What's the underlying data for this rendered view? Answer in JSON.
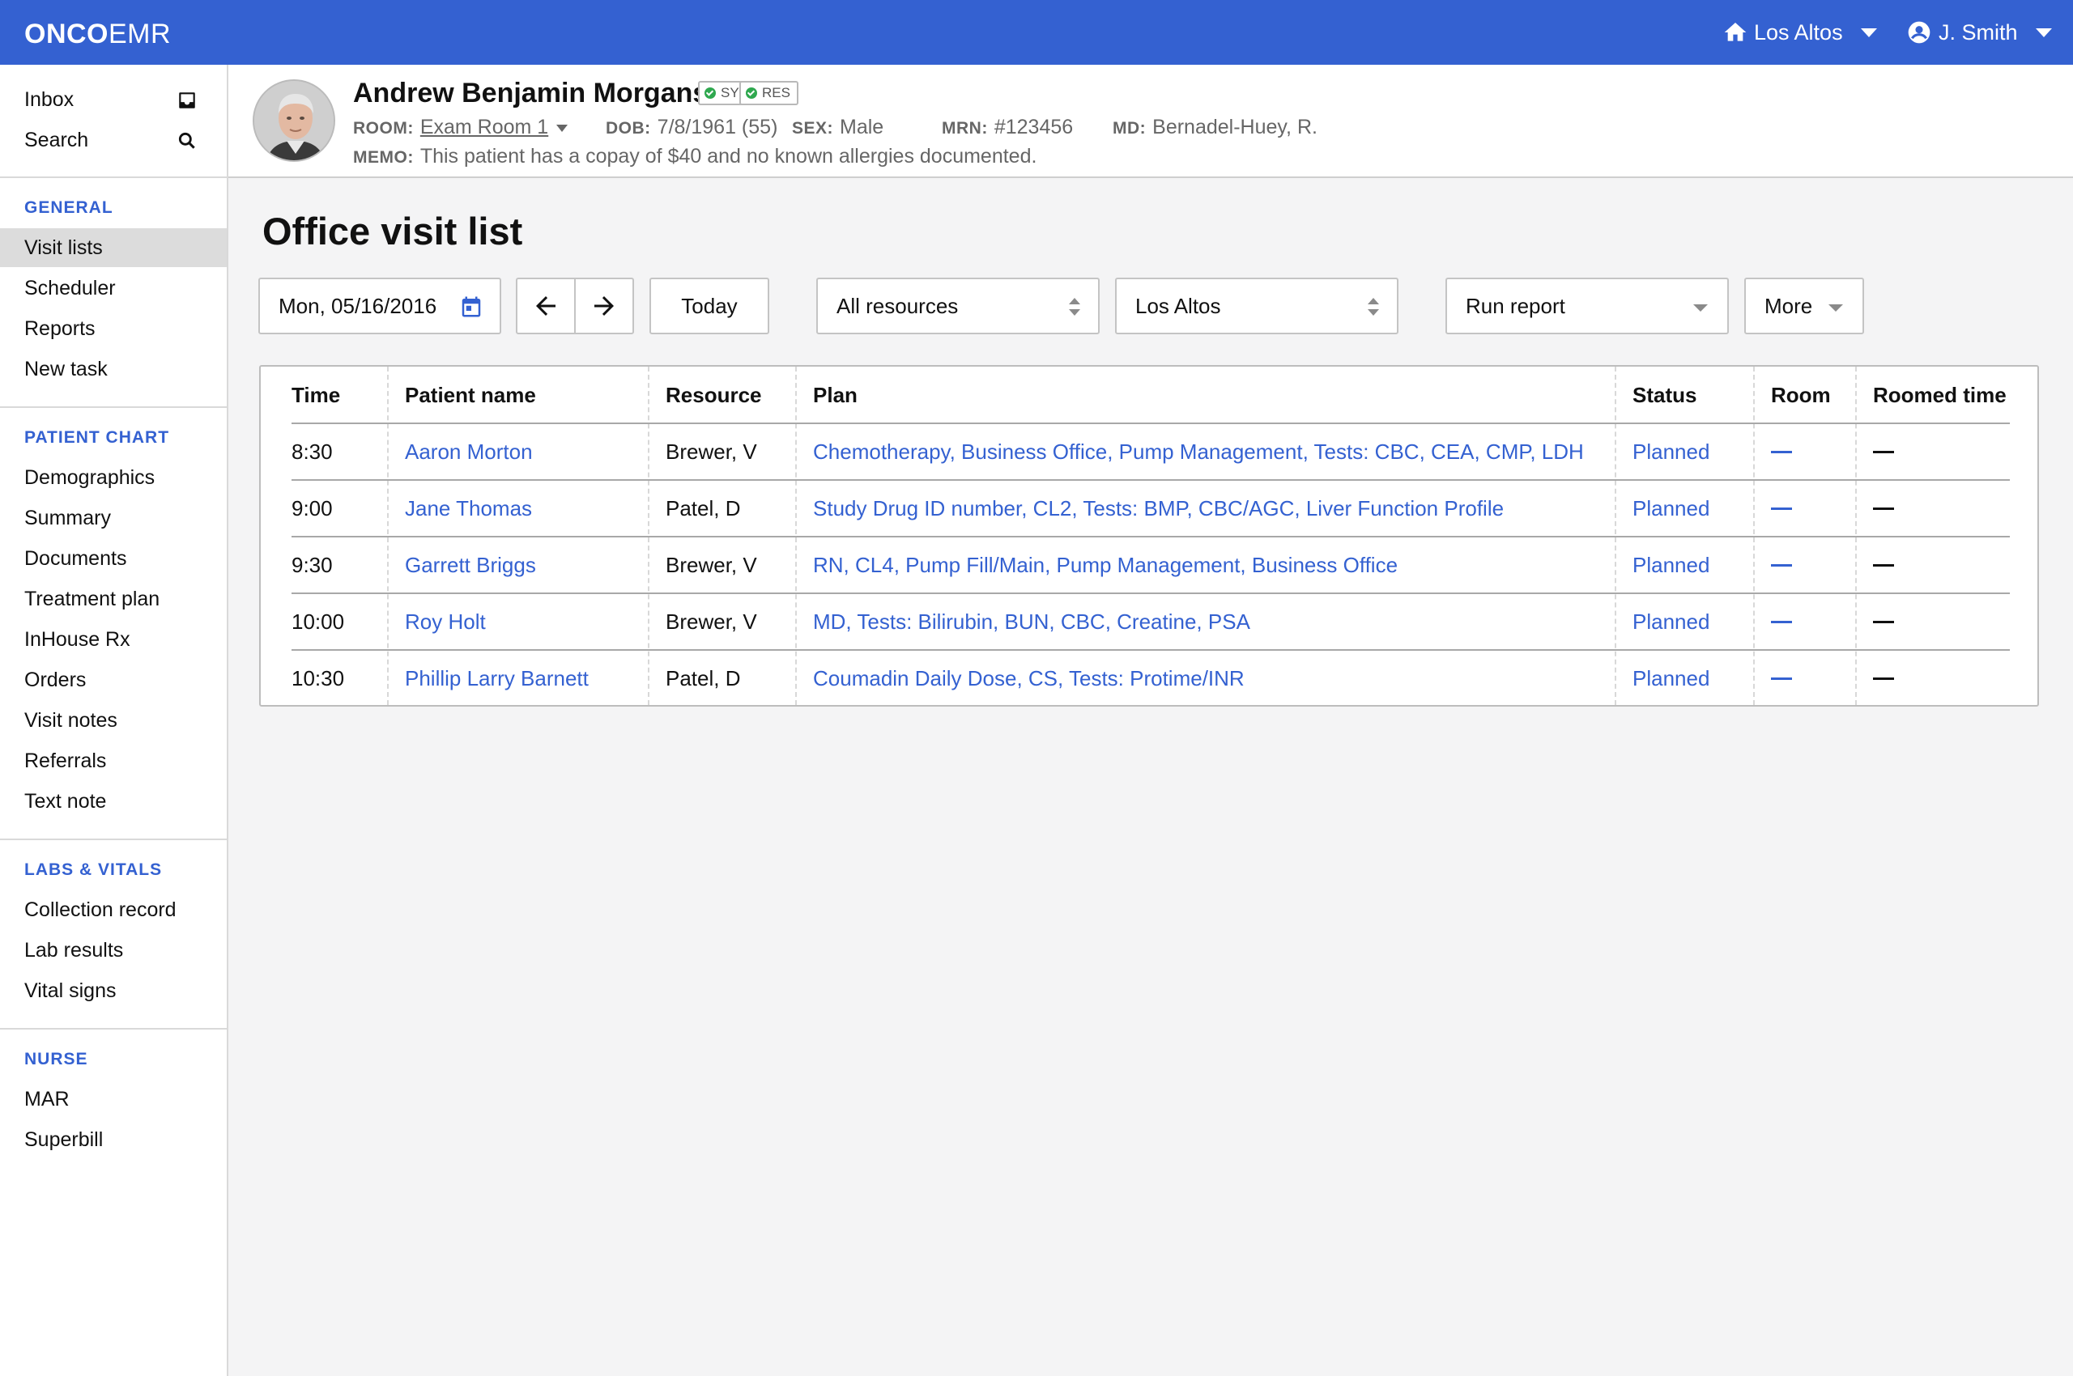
{
  "app": {
    "logo_bold": "ONCO",
    "logo_light": "EMR",
    "location": "Los Altos",
    "user": "J. Smith"
  },
  "sidebar": {
    "top": [
      {
        "label": "Inbox",
        "icon": "inbox-icon"
      },
      {
        "label": "Search",
        "icon": "search-icon"
      }
    ],
    "sections": [
      {
        "heading": "GENERAL",
        "items": [
          "Visit lists",
          "Scheduler",
          "Reports",
          "New task"
        ]
      },
      {
        "heading": "PATIENT CHART",
        "items": [
          "Demographics",
          "Summary",
          "Documents",
          "Treatment plan",
          "InHouse Rx",
          "Orders",
          "Visit notes",
          "Referrals",
          "Text note"
        ]
      },
      {
        "heading": "LABS & VITALS",
        "items": [
          "Collection record",
          "Lab results",
          "Vital signs"
        ]
      },
      {
        "heading": "NURSE",
        "items": [
          "MAR",
          "Superbill"
        ]
      }
    ],
    "active": "Visit lists"
  },
  "patient": {
    "name": "Andrew Benjamin Morganstein",
    "tags": [
      "SYC",
      "RES"
    ],
    "room_key": "ROOM:",
    "room": "Exam Room 1",
    "dob_key": "DOB:",
    "dob": "7/8/1961 (55)",
    "sex_key": "SEX:",
    "sex": "Male",
    "mrn_key": "MRN:",
    "mrn": "#123456",
    "md_key": "MD:",
    "md": "Bernadel-Huey, R.",
    "memo_key": "MEMO:",
    "memo": "This patient has a copay of $40 and no known allergies documented."
  },
  "page": {
    "title": "Office visit list",
    "date": "Mon, 05/16/2016",
    "today": "Today",
    "resources": "All resources",
    "location": "Los Altos",
    "run_report": "Run report",
    "more": "More"
  },
  "table": {
    "headers": [
      "Time",
      "Patient name",
      "Resource",
      "Plan",
      "Status",
      "Room",
      "Roomed time"
    ],
    "rows": [
      {
        "time": "8:30",
        "patient": "Aaron Morton",
        "resource": "Brewer, V",
        "plan": "Chemotherapy, Business Office, Pump Management, Tests: CBC, CEA, CMP, LDH",
        "status": "Planned"
      },
      {
        "time": "9:00",
        "patient": "Jane Thomas",
        "resource": "Patel, D",
        "plan": "Study Drug ID number, CL2, Tests: BMP, CBC/AGC, Liver Function Profile",
        "status": "Planned"
      },
      {
        "time": "9:30",
        "patient": "Garrett Briggs",
        "resource": "Brewer, V",
        "plan": "RN, CL4, Pump Fill/Main, Pump Management, Business Office",
        "status": "Planned"
      },
      {
        "time": "10:00",
        "patient": "Roy Holt",
        "resource": "Brewer, V",
        "plan": "MD, Tests: Bilirubin, BUN, CBC, Creatine, PSA",
        "status": "Planned"
      },
      {
        "time": "10:30",
        "patient": "Phillip Larry Barnett",
        "resource": "Patel, D",
        "plan": "Coumadin Daily Dose, CS, Tests: Protime/INR",
        "status": "Planned"
      }
    ]
  },
  "colors": {
    "brand": "#3461d1",
    "status_ok": "#2fa84f"
  }
}
